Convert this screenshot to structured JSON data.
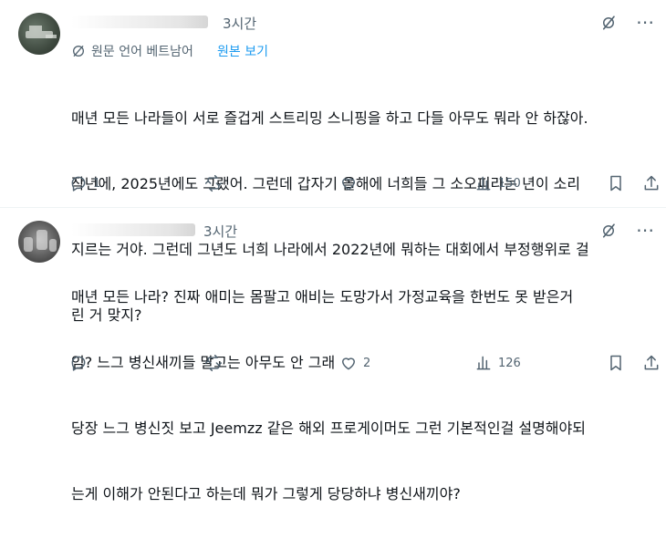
{
  "colors": {
    "text": "#0f1419",
    "muted": "#536471",
    "link": "#1d9bf0",
    "divider": "#eff3f4"
  },
  "posts": [
    {
      "time": "3시간",
      "translate": {
        "label": "원문 언어 베트남어",
        "link": "원본 보기",
        "icon": "translate-icon"
      },
      "lines": [
        "매년 모든 나라들이 서로 즐겁게 스트리밍 스니핑을 하고 다들 아무도 뭐라 안 하잖아.",
        "작년에, 2025년에도 그랬어. 그런데 갑자기 올해에 너희들 그 소오피라는 년이 소리",
        "지르는 거야. 그런데 그년도 너희 나라에서 2022년에 뭐하는 대회에서 부정행위로 걸",
        "린 거 맞지?"
      ],
      "actions": {
        "reply": "1",
        "repost": "",
        "like": "",
        "views": "150"
      }
    },
    {
      "time": "3시간",
      "lines": [
        "매년 모든 나라? 진짜 애미는 몸팔고 애비는 도망가서 가정교육을 한번도 못 받은거",
        "임? 느그 병신새끼들 말고는 아무도 안 그래",
        "당장 느그 병신짓 보고 Jeemzz 같은 해외 프로게이머도 그런 기본적인걸 설명해야되",
        "는게 이해가 안된다고 하는데 뭐가 그렇게 당당하냐 병신새끼야?"
      ],
      "actions": {
        "reply": "",
        "repost": "",
        "like": "2",
        "views": "126"
      }
    }
  ]
}
